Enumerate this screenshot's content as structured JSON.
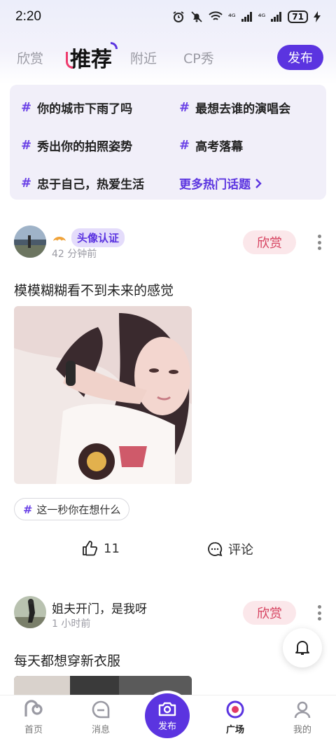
{
  "status_bar": {
    "time": "2:20",
    "signal_1": "⁴ᴳ",
    "signal_2": "⁴ᴳ",
    "battery": "71"
  },
  "tabs": [
    {
      "label": "欣赏"
    },
    {
      "label": "推荐"
    },
    {
      "label": "附近"
    },
    {
      "label": "CP秀"
    }
  ],
  "publish_button": "发布",
  "topics": [
    {
      "label": "你的城市下雨了吗"
    },
    {
      "label": "最想去谁的演唱会"
    },
    {
      "label": "秀出你的拍照姿势"
    },
    {
      "label": "高考落幕"
    },
    {
      "label": "忠于自己，热爱生活"
    }
  ],
  "more_topics": "更多热门话题",
  "posts": [
    {
      "badge": "头像认证",
      "time": "42 分钟前",
      "admire": "欣赏",
      "title": "模模糊糊看不到未来的感觉",
      "tag": "这一秒你在想什么",
      "likes": "11",
      "comment": "评论"
    },
    {
      "name": "姐夫开门，是我呀",
      "time": "1 小时前",
      "admire": "欣赏",
      "title": "每天都想穿新衣服"
    }
  ],
  "bottom_nav": [
    {
      "label": "首页"
    },
    {
      "label": "消息"
    },
    {
      "label": "发布"
    },
    {
      "label": "广场"
    },
    {
      "label": "我的"
    }
  ],
  "colors": {
    "accent": "#5b34e0",
    "admire": "#d6405e",
    "topic_bg": "#f1eff9"
  }
}
